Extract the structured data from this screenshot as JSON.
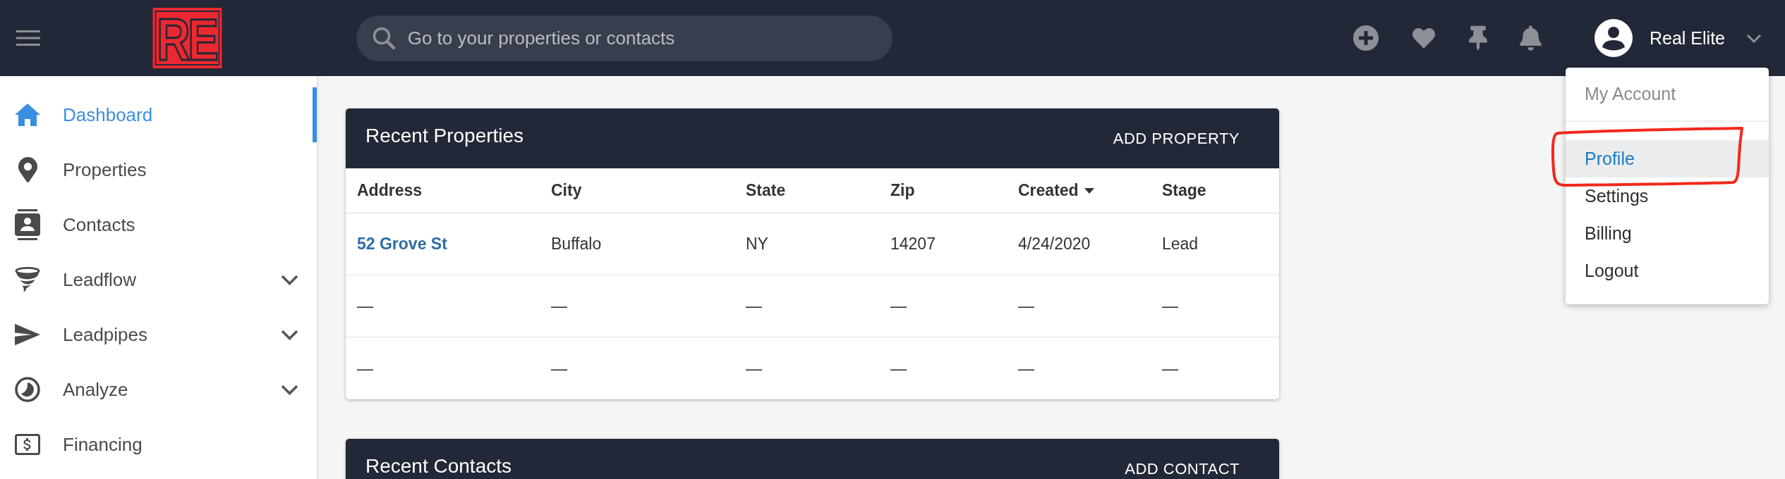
{
  "topbar": {
    "logo": "RE",
    "search": {
      "placeholder": "Go to your properties or contacts"
    },
    "user": {
      "name": "Real Elite"
    }
  },
  "account_menu": {
    "open": true,
    "header": "My Account",
    "items": [
      {
        "label": "Profile",
        "highlighted": true,
        "circled": true
      },
      {
        "label": "Settings",
        "highlighted": false,
        "circled": false
      },
      {
        "label": "Billing",
        "highlighted": false,
        "circled": false
      },
      {
        "label": "Logout",
        "highlighted": false,
        "circled": false
      }
    ]
  },
  "sidebar": {
    "items": [
      {
        "label": "Dashboard",
        "kind": "link",
        "selected": true
      },
      {
        "label": "Properties",
        "kind": "link",
        "selected": false
      },
      {
        "label": "Contacts",
        "kind": "link",
        "selected": false
      },
      {
        "label": "Leadflow",
        "kind": "group",
        "selected": false,
        "expanded": false
      },
      {
        "label": "Leadpipes",
        "kind": "group",
        "selected": false,
        "expanded": false
      },
      {
        "label": "Analyze",
        "kind": "group",
        "selected": false,
        "expanded": false
      },
      {
        "label": "Financing",
        "kind": "link",
        "selected": false
      }
    ]
  },
  "cards": [
    {
      "title": "Recent Properties",
      "action": "ADD PROPERTY",
      "table": {
        "columns": [
          {
            "label": "Address",
            "sorted": false
          },
          {
            "label": "City",
            "sorted": false
          },
          {
            "label": "State",
            "sorted": false
          },
          {
            "label": "Zip",
            "sorted": false
          },
          {
            "label": "Created",
            "sorted": true
          },
          {
            "label": "Stage",
            "sorted": false
          }
        ],
        "rows": [
          {
            "cells": [
              {
                "kind": "link",
                "text": "52 Grove St"
              },
              {
                "kind": "text",
                "text": "Buffalo"
              },
              {
                "kind": "text",
                "text": "NY"
              },
              {
                "kind": "text",
                "text": "14207"
              },
              {
                "kind": "text",
                "text": "4/24/2020"
              },
              {
                "kind": "text",
                "text": "Lead"
              }
            ]
          },
          {
            "cells": [
              {
                "kind": "text",
                "text": "—"
              },
              {
                "kind": "text",
                "text": "—"
              },
              {
                "kind": "text",
                "text": "—"
              },
              {
                "kind": "text",
                "text": "—"
              },
              {
                "kind": "text",
                "text": "—"
              },
              {
                "kind": "text",
                "text": "—"
              }
            ]
          },
          {
            "cells": [
              {
                "kind": "text",
                "text": "—"
              },
              {
                "kind": "text",
                "text": "—"
              },
              {
                "kind": "text",
                "text": "—"
              },
              {
                "kind": "text",
                "text": "—"
              },
              {
                "kind": "text",
                "text": "—"
              },
              {
                "kind": "text",
                "text": "—"
              }
            ]
          }
        ]
      }
    },
    {
      "title": "Recent Contacts",
      "action": "ADD CONTACT"
    }
  ]
}
